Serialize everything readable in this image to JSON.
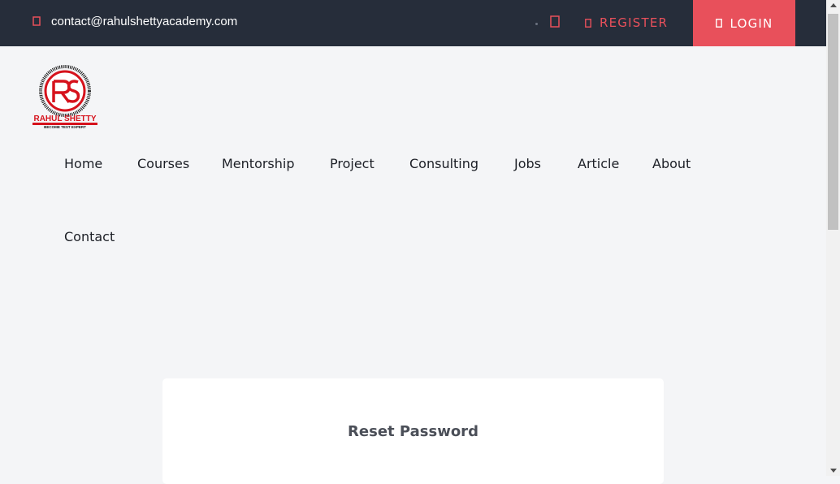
{
  "topbar": {
    "email": "contact@rahulshettyacademy.com",
    "register_label": "REGISTER",
    "login_label": "LOGIN",
    "icons": [
      "envelope-icon",
      "cart-icon",
      "user-icon",
      "lock-icon"
    ]
  },
  "logo": {
    "monogram": "RS",
    "name": "RAHUL SHETTY",
    "tagline": "BECOME TEST EXPERT"
  },
  "nav": {
    "items": [
      {
        "label": "Home"
      },
      {
        "label": "Courses"
      },
      {
        "label": "Mentorship"
      },
      {
        "label": "Project"
      },
      {
        "label": "Consulting"
      },
      {
        "label": "Jobs"
      },
      {
        "label": "Article"
      },
      {
        "label": "About"
      },
      {
        "label": "Contact"
      }
    ]
  },
  "card": {
    "title": "Reset Password"
  },
  "colors": {
    "topbar_bg": "#262d3a",
    "accent": "#e8505b",
    "page_bg": "#f4f5f7",
    "card_bg": "#ffffff"
  }
}
